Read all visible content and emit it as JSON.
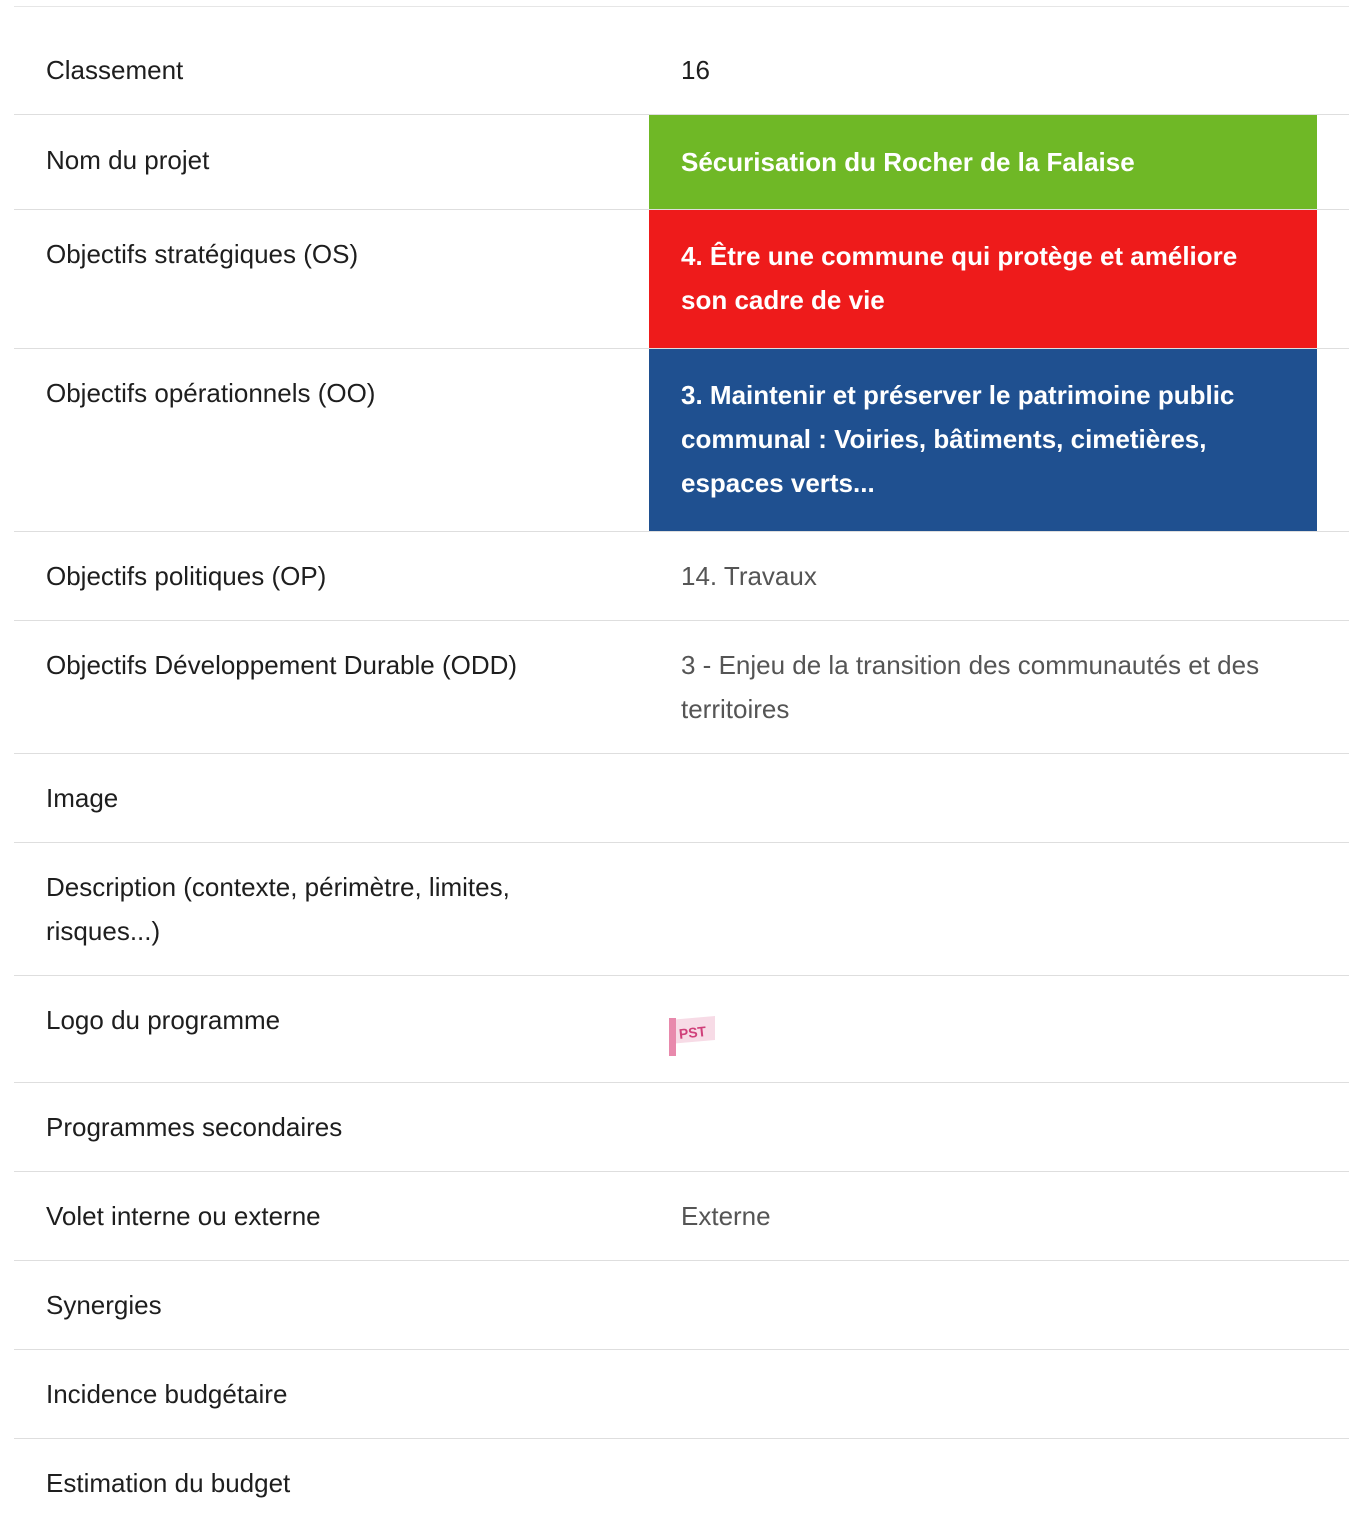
{
  "rows": [
    {
      "label": "Classement",
      "value": "16"
    },
    {
      "label": "Nom du projet",
      "value": "Sécurisation du Rocher de la Falaise",
      "color": "#6fb826"
    },
    {
      "label": "Objectifs stratégiques (OS)",
      "value": "4. Être une commune qui protège et améliore son cadre de vie",
      "color": "#ee1b1b"
    },
    {
      "label": "Objectifs opérationnels (OO)",
      "value": "3. Maintenir et préserver le patrimoine public communal : Voiries, bâtiments, cimetières, espaces verts...",
      "color": "#1f5090"
    },
    {
      "label": "Objectifs politiques (OP)",
      "value": "14. Travaux"
    },
    {
      "label": "Objectifs Développement Durable (ODD)",
      "value": "3 - Enjeu de la transition des communautés et des territoires"
    },
    {
      "label": "Image",
      "value": ""
    },
    {
      "label": "Description (contexte, périmètre, limites, risques...)",
      "value": ""
    },
    {
      "label": "Logo du programme",
      "logo_text": "PST"
    },
    {
      "label": "Programmes secondaires",
      "value": ""
    },
    {
      "label": "Volet interne ou externe",
      "value": "Externe"
    },
    {
      "label": "Synergies",
      "value": ""
    },
    {
      "label": "Incidence budgétaire",
      "value": ""
    },
    {
      "label": "Estimation du budget",
      "value": ""
    }
  ]
}
